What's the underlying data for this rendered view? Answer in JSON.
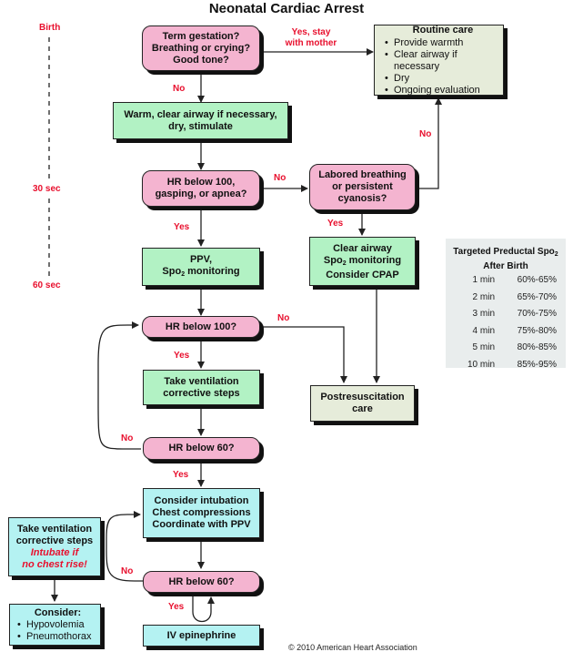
{
  "title": "Neonatal Cardiac Arrest",
  "timeline": {
    "labels": [
      "Birth",
      "30 sec",
      "60 sec"
    ]
  },
  "nodes": {
    "term_gestation": {
      "lines": [
        "Term gestation?",
        "Breathing or crying?",
        "Good tone?"
      ]
    },
    "routine_care": {
      "heading": "Routine care",
      "bullets": [
        "Provide warmth",
        "Clear airway if necessary",
        "Dry",
        "Ongoing evaluation"
      ]
    },
    "warm_clear": {
      "lines": [
        "Warm, clear airway if necessary,",
        "dry, stimulate"
      ]
    },
    "hr_below_100_gasping": {
      "lines": [
        "HR below 100,",
        "gasping, or apnea?"
      ]
    },
    "labored_breathing": {
      "lines": [
        "Labored breathing",
        "or persistent",
        "cyanosis?"
      ]
    },
    "ppv": {
      "line1": "PPV,",
      "line2_prefix": "Spo",
      "line2_sub": "2",
      "line2_suffix": " monitoring"
    },
    "clear_airway": {
      "line1": "Clear airway",
      "line2_prefix": "Spo",
      "line2_sub": "2",
      "line2_suffix": " monitoring",
      "line3": "Consider CPAP"
    },
    "hr_below_100": {
      "lines": [
        "HR below 100?"
      ]
    },
    "take_ventilation": {
      "lines": [
        "Take ventilation",
        "corrective steps"
      ]
    },
    "postresuscitation": {
      "lines": [
        "Postresuscitation",
        "care"
      ]
    },
    "hr_below_60_a": {
      "lines": [
        "HR below 60?"
      ]
    },
    "consider_intubation": {
      "lines": [
        "Consider intubation",
        "Chest compressions",
        "Coordinate with PPV"
      ]
    },
    "take_ventilation_2": {
      "lines": [
        "Take ventilation",
        "corrective steps"
      ],
      "italic_lines": [
        "Intubate if",
        "no chest rise!"
      ]
    },
    "hr_below_60_b": {
      "lines": [
        "HR below 60?"
      ]
    },
    "consider": {
      "heading": "Consider:",
      "bullets": [
        "Hypovolemia",
        "Pneumothorax"
      ]
    },
    "iv_epinephrine": {
      "lines": [
        "IV epinephrine"
      ]
    }
  },
  "edge_labels": {
    "yes_stay": [
      "Yes, stay",
      "with mother"
    ],
    "no_1": "No",
    "no_2": "No",
    "no_routine": "No",
    "yes_1": "Yes",
    "yes_2": "Yes",
    "no_3": "No",
    "yes_3": "Yes",
    "no_4": "No",
    "yes_4": "Yes",
    "no_5": "No",
    "yes_5": "Yes"
  },
  "spo2_table": {
    "title_prefix": "Targeted Preductal Spo",
    "title_sub": "2",
    "title_line2": "After Birth",
    "rows": [
      {
        "time": "1 min",
        "range": "60%-65%"
      },
      {
        "time": "2 min",
        "range": "65%-70%"
      },
      {
        "time": "3 min",
        "range": "70%-75%"
      },
      {
        "time": "4 min",
        "range": "75%-80%"
      },
      {
        "time": "5 min",
        "range": "80%-85%"
      },
      {
        "time": "10 min",
        "range": "85%-95%"
      }
    ]
  },
  "copyright": "© 2010 American Heart Association",
  "colors": {
    "decision": "#f4b4d0",
    "action": "#b2f2c4",
    "advanced": "#b4f2f2",
    "care": "#e6ecda",
    "label_red": "#e8102e"
  }
}
